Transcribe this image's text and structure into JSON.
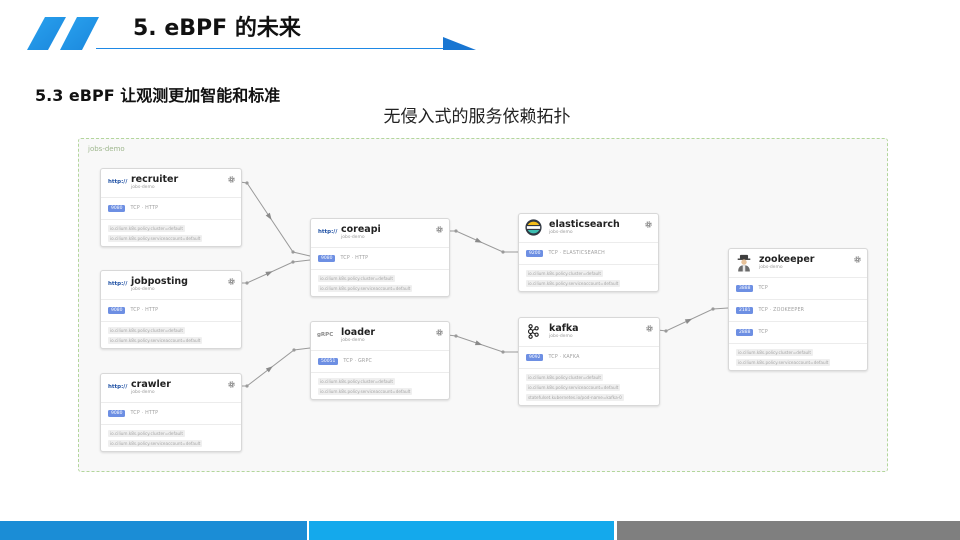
{
  "slide": {
    "title": "5. eBPF 的未来",
    "section": "5.3 eBPF 让观测更加智能和标准",
    "caption": "无侵入式的服务依赖拓扑"
  },
  "topology": {
    "namespace_label": "jobs-demo",
    "nodes": [
      {
        "name": "recruiter",
        "namespace": "jobs-demo",
        "icon": "http-icon",
        "icon_text": "http://",
        "ports": [
          {
            "port": "9080",
            "protocol": "TCP · HTTP"
          }
        ],
        "labels": [
          "io.cilium.k8s.policy.cluster=default",
          "io.cilium.k8s.policy.serviceaccount=default"
        ]
      },
      {
        "name": "jobposting",
        "namespace": "jobs-demo",
        "icon": "http-icon",
        "icon_text": "http://",
        "ports": [
          {
            "port": "9080",
            "protocol": "TCP · HTTP"
          }
        ],
        "labels": [
          "io.cilium.k8s.policy.cluster=default",
          "io.cilium.k8s.policy.serviceaccount=default"
        ]
      },
      {
        "name": "crawler",
        "namespace": "jobs-demo",
        "icon": "http-icon",
        "icon_text": "http://",
        "ports": [
          {
            "port": "9080",
            "protocol": "TCP · HTTP"
          }
        ],
        "labels": [
          "io.cilium.k8s.policy.cluster=default",
          "io.cilium.k8s.policy.serviceaccount=default"
        ]
      },
      {
        "name": "coreapi",
        "namespace": "jobs-demo",
        "icon": "http-icon",
        "icon_text": "http://",
        "ports": [
          {
            "port": "9080",
            "protocol": "TCP · HTTP"
          }
        ],
        "labels": [
          "io.cilium.k8s.policy.cluster=default",
          "io.cilium.k8s.policy.serviceaccount=default"
        ]
      },
      {
        "name": "loader",
        "namespace": "jobs-demo",
        "icon": "grpc-icon",
        "icon_text": "gRPC",
        "ports": [
          {
            "port": "50051",
            "protocol": "TCP · GRPC"
          }
        ],
        "labels": [
          "io.cilium.k8s.policy.cluster=default",
          "io.cilium.k8s.policy.serviceaccount=default"
        ]
      },
      {
        "name": "elasticsearch",
        "namespace": "jobs-demo",
        "icon": "elasticsearch-icon",
        "ports": [
          {
            "port": "9200",
            "protocol": "TCP · ELASTICSEARCH"
          }
        ],
        "labels": [
          "io.cilium.k8s.policy.cluster=default",
          "io.cilium.k8s.policy.serviceaccount=default"
        ]
      },
      {
        "name": "kafka",
        "namespace": "jobs-demo",
        "icon": "kafka-icon",
        "ports": [
          {
            "port": "9092",
            "protocol": "TCP · KAFKA"
          }
        ],
        "labels": [
          "io.cilium.k8s.policy.cluster=default",
          "io.cilium.k8s.policy.serviceaccount=default",
          "statefulset.kubernetes.io/pod-name=kafka-0"
        ]
      },
      {
        "name": "zookeeper",
        "namespace": "jobs-demo",
        "icon": "zookeeper-icon",
        "ports": [
          {
            "port": "3888",
            "protocol": "TCP"
          },
          {
            "port": "2181",
            "protocol": "TCP · ZOOKEEPER"
          },
          {
            "port": "2888",
            "protocol": "TCP"
          }
        ],
        "labels": [
          "io.cilium.k8s.policy.cluster=default",
          "io.cilium.k8s.policy.serviceaccount=default"
        ]
      }
    ]
  },
  "colors": {
    "accent": "#1e88e5",
    "frame_border": "#b3d69c",
    "port_badge": "#6d8fe3",
    "edge": "#9a9a9a",
    "bar_left": "#1b8dd6",
    "bar_middle": "#14a9ec",
    "bar_right": "#7f7f7f"
  }
}
